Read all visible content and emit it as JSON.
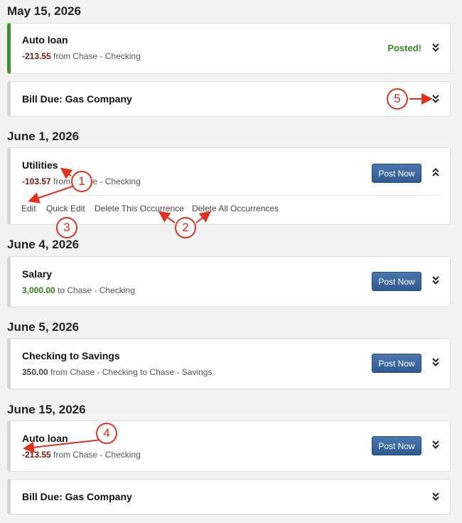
{
  "colors": {
    "posted_bar": "#3f8e2f",
    "negative_amount": "#7a1212",
    "positive_amount": "#2f7d1f",
    "button": "#3a6aa3",
    "annotation": "#e0301e"
  },
  "groups": [
    {
      "date": "May 15, 2026",
      "items": [
        {
          "title": "Auto loan",
          "amount": "-213.55",
          "detail": " from Chase - Checking",
          "status": "Posted!",
          "chevron": "chevron-double-down-icon"
        },
        {
          "title": "Bill Due: Gas Company",
          "chevron": "chevron-double-down-icon"
        }
      ]
    },
    {
      "date": "June 1, 2026",
      "items": [
        {
          "title": "Utilities",
          "amount": "-103.57",
          "detail": " from Chase - Checking",
          "button": "Post Now",
          "chevron": "chevron-double-up-icon",
          "actions": [
            "Edit",
            "Quick Edit",
            "Delete This Occurrence",
            "Delete All Occurrences"
          ]
        }
      ]
    },
    {
      "date": "June 4, 2026",
      "items": [
        {
          "title": "Salary",
          "amount": "3,000.00",
          "detail": " to Chase - Checking",
          "button": "Post Now",
          "chevron": "chevron-double-down-icon"
        }
      ]
    },
    {
      "date": "June 5, 2026",
      "items": [
        {
          "title": "Checking to Savings",
          "amount": "350.00",
          "detail": " from Chase - Checking to Chase - Savings",
          "button": "Post Now",
          "chevron": "chevron-double-down-icon"
        }
      ]
    },
    {
      "date": "June 15, 2026",
      "items": [
        {
          "title": "Auto loan",
          "amount": "-213.55",
          "detail": " from Chase - Checking",
          "button": "Post Now",
          "chevron": "chevron-double-down-icon"
        },
        {
          "title": "Bill Due: Gas Company",
          "chevron": "chevron-double-down-icon"
        }
      ]
    }
  ],
  "annotations": [
    "1",
    "2",
    "3",
    "4",
    "5"
  ]
}
